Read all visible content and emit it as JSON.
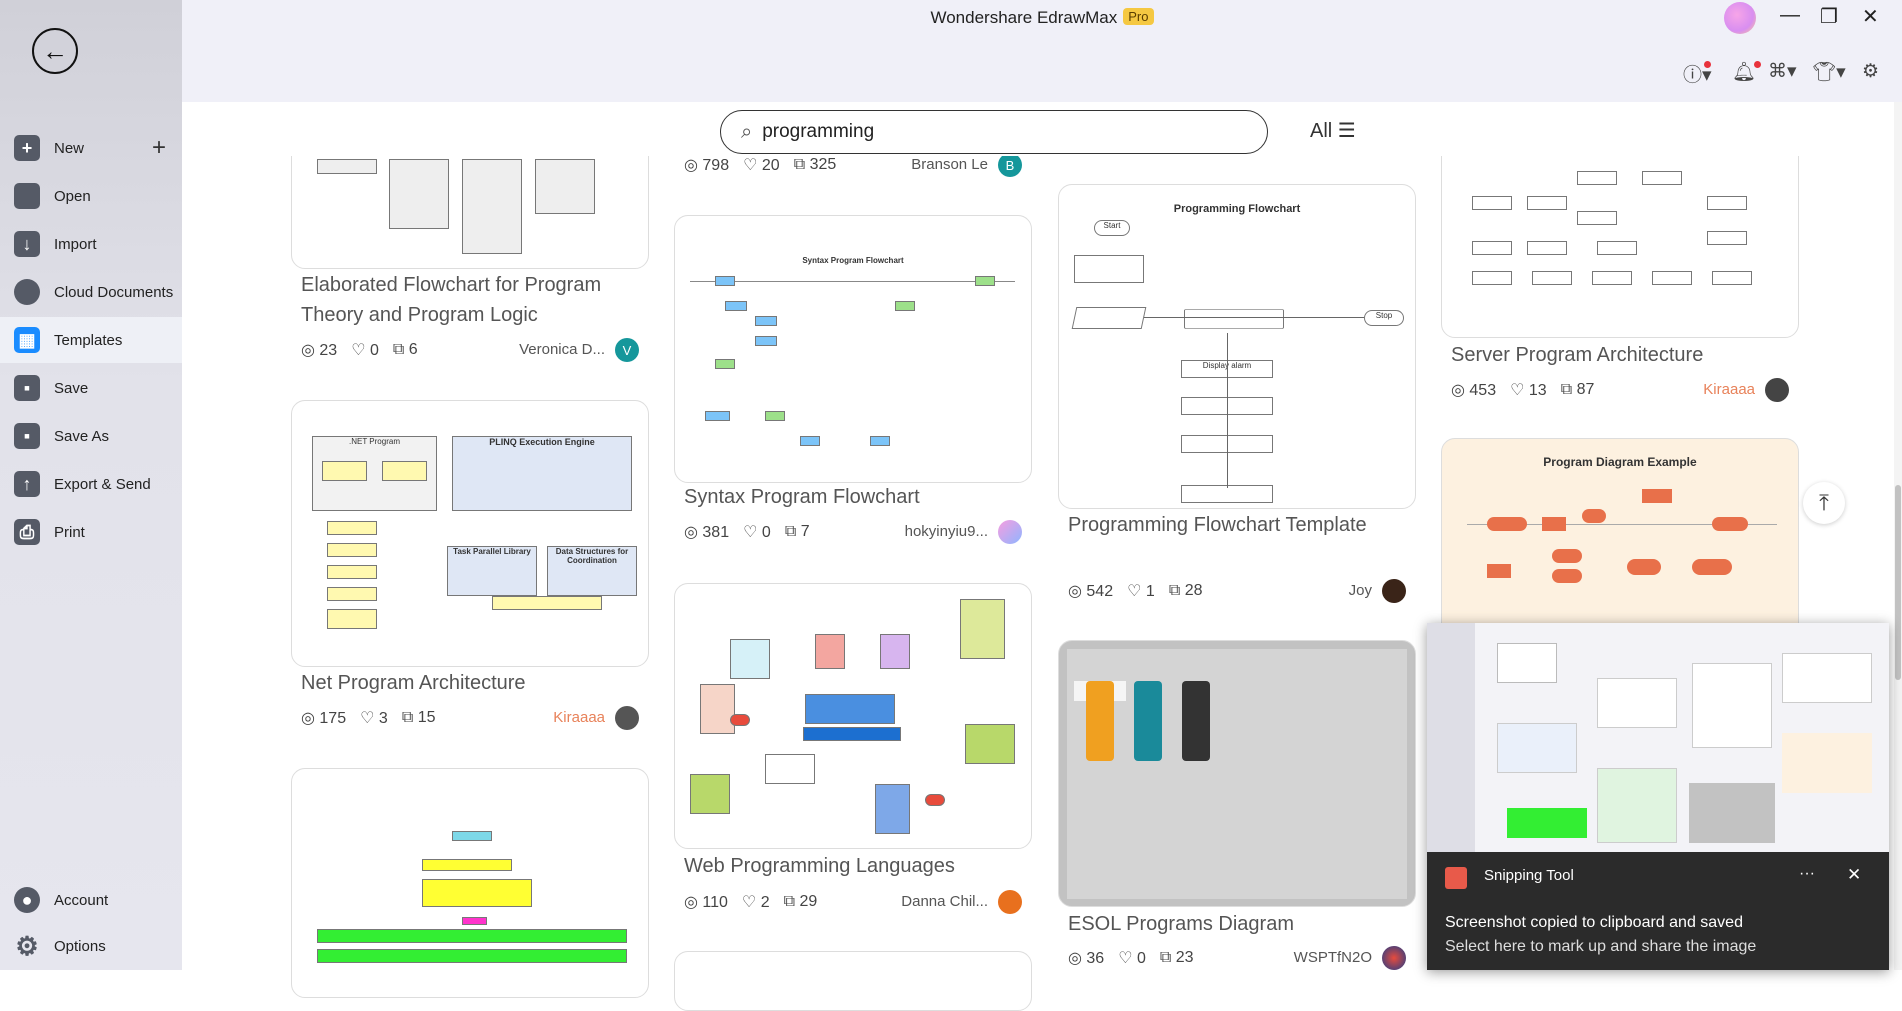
{
  "app": {
    "title": "Wondershare EdrawMax",
    "badge": "Pro"
  },
  "sidebar": {
    "items": [
      {
        "label": "New",
        "icon": "plus-square-icon"
      },
      {
        "label": "Open",
        "icon": "folder-icon"
      },
      {
        "label": "Import",
        "icon": "import-icon"
      },
      {
        "label": "Cloud Documents",
        "icon": "cloud-icon"
      },
      {
        "label": "Templates",
        "icon": "templates-icon",
        "active": true
      },
      {
        "label": "Save",
        "icon": "save-icon"
      },
      {
        "label": "Save As",
        "icon": "save-as-icon"
      },
      {
        "label": "Export & Send",
        "icon": "export-icon"
      },
      {
        "label": "Print",
        "icon": "print-icon"
      }
    ],
    "bottom": [
      {
        "label": "Account",
        "icon": "account-icon"
      },
      {
        "label": "Options",
        "icon": "gear-icon"
      }
    ]
  },
  "search": {
    "value": "programming"
  },
  "filter": {
    "label": "All"
  },
  "colors": {
    "accent": "#1a8cff",
    "author_highlight": "#e8825a",
    "toast_bg": "#2b2b2b"
  },
  "cards": [
    {
      "title": "Elaborated Flowchart for Program Theory and Program Logic",
      "views": "23",
      "likes": "0",
      "copies": "6",
      "author": "Veronica D...",
      "avatar": "V"
    },
    {
      "title": "Net Program Architecture",
      "views": "175",
      "likes": "3",
      "copies": "15",
      "author": "Kiraaaa",
      "thumb": {
        "a": ".NET Program",
        "b": "PLINQ Execution Engine",
        "c": "Task Parallel Library",
        "d": "Data Structures for Coordination"
      }
    },
    {
      "title": "",
      "views": "798",
      "likes": "20",
      "copies": "325",
      "author": "Branson Le",
      "avatar": "B"
    },
    {
      "title": "Syntax Program Flowchart",
      "views": "381",
      "likes": "0",
      "copies": "7",
      "author": "hokyinyiu9...",
      "thumb": {
        "a": "Syntax Program Flowchart"
      }
    },
    {
      "title": "Web Programming Languages",
      "views": "110",
      "likes": "2",
      "copies": "29",
      "author": "Danna Chil..."
    },
    {
      "title": "Programming Flowchart Template",
      "views": "542",
      "likes": "1",
      "copies": "28",
      "author": "Joy",
      "thumb": {
        "a": "Programming Flowchart",
        "b": "Start",
        "c": "Display alarm",
        "d": "Stop"
      }
    },
    {
      "title": "ESOL Programs Diagram",
      "views": "36",
      "likes": "0",
      "copies": "23",
      "author": "WSPTfN2O"
    },
    {
      "title": "Server Program Architecture",
      "views": "453",
      "likes": "13",
      "copies": "87",
      "author": "Kiraaaa"
    },
    {
      "title": "",
      "thumb": {
        "a": "Program Diagram Example"
      }
    }
  ],
  "toast": {
    "app": "Snipping Tool",
    "title": "Screenshot copied to clipboard and saved",
    "subtitle": "Select here to mark up and share the image",
    "more": "···",
    "close": "✕"
  }
}
